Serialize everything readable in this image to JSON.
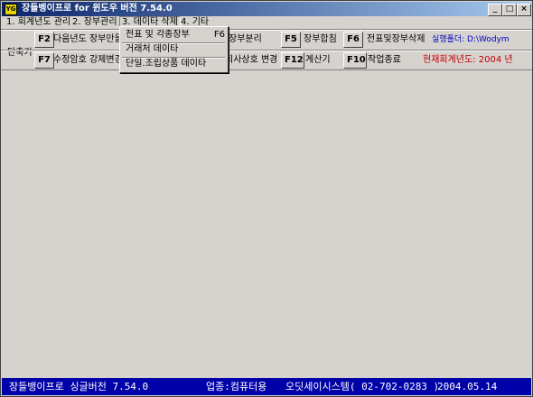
{
  "window": {
    "app_icon_text": "YG",
    "title": "장들벵이프로 for 윈도우 버전 7.54.0",
    "minimize": "_",
    "maximize": "□",
    "close": "×"
  },
  "menu": {
    "items": [
      "1. 회계년도 관리",
      "2. 장부관리",
      "3. 데이타 삭제",
      "4. 기타"
    ]
  },
  "dropdown": {
    "items": [
      {
        "label": "전표 및 각종장부",
        "shortcut": "F6"
      },
      {
        "label": "거래처 데이타",
        "shortcut": ""
      },
      {
        "label": "단일.조립상품 데이타",
        "shortcut": ""
      }
    ]
  },
  "shortcuts": {
    "label": "단축키",
    "row1": [
      {
        "key": "F2",
        "label": "다음년도 장부만들"
      },
      {
        "key": "",
        "label": "장부분리"
      },
      {
        "key": "F5",
        "label": "장부합침"
      },
      {
        "key": "F6",
        "label": "전표및장부삭제"
      }
    ],
    "row2": [
      {
        "key": "F7",
        "label": "수정암호 강제변경"
      },
      {
        "key": "",
        "label": "회사상호 변경"
      },
      {
        "key": "F12",
        "label": "계산기"
      },
      {
        "key": "F10",
        "label": "작업종료"
      }
    ],
    "exec_folder": "실행폴더: D:\\Wodym",
    "current_year": "현재회계년도: 2004 년"
  },
  "status": {
    "product": "장들뱅이프로 싱글버전 7.54.0",
    "business": "업종:컴퓨터용",
    "company": "오딧세이시스템( 02-702-0283 )",
    "date": "2004.05.14"
  },
  "colors": {
    "title_start": "#0a246a",
    "status_bg": "#0000a8",
    "info_blue": "#0000c0",
    "info_red": "#c00000"
  }
}
